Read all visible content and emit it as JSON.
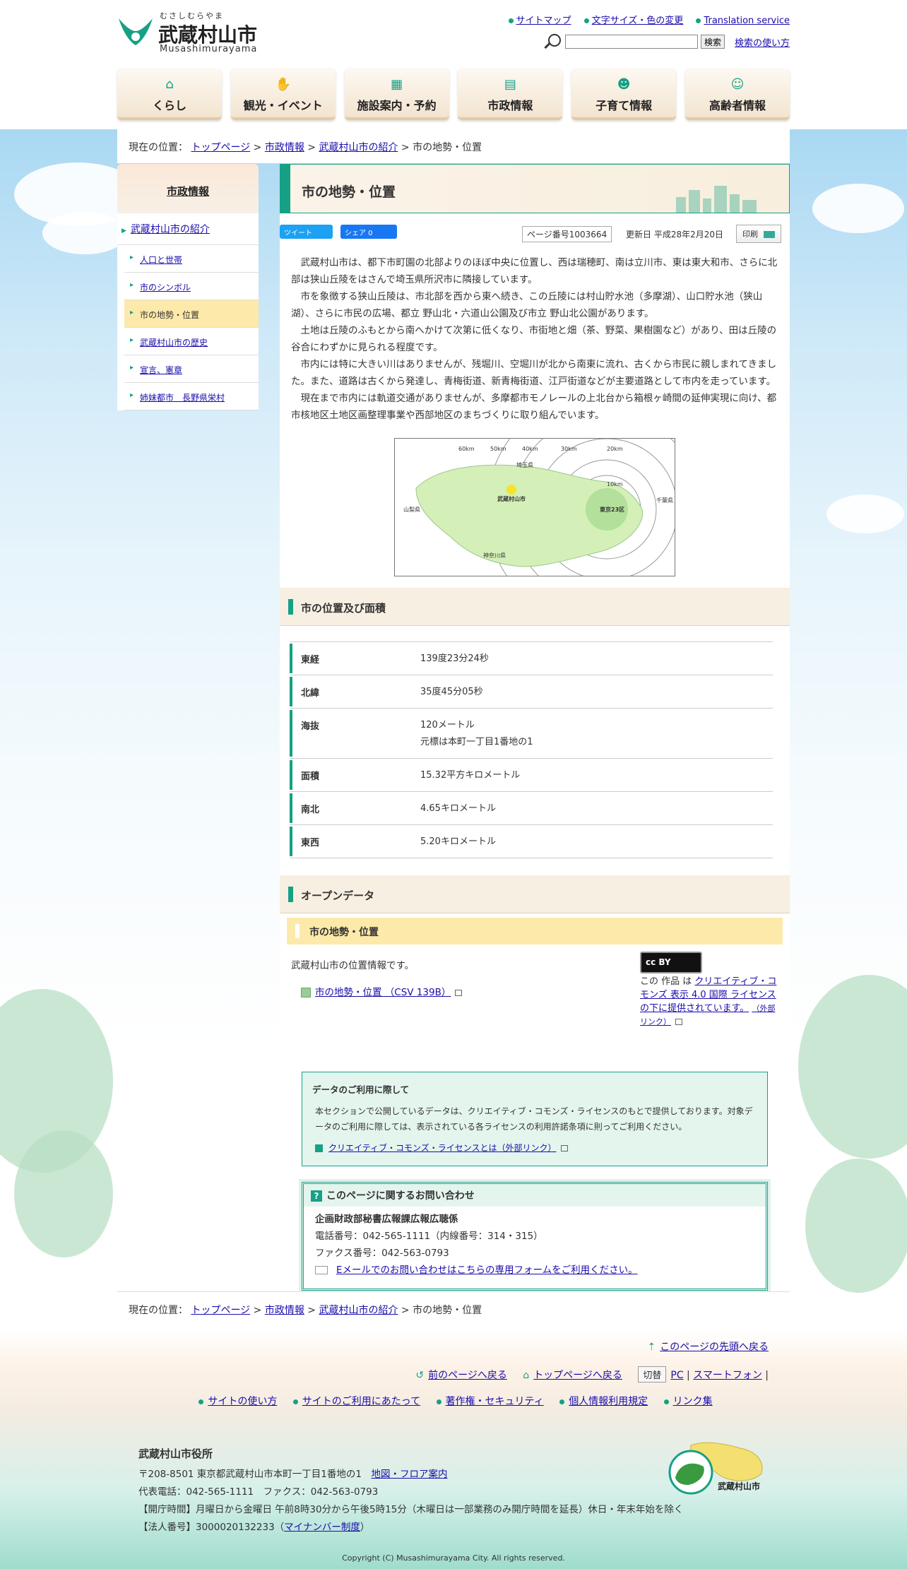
{
  "site": {
    "logo_kana": "むさしむらやま",
    "logo_name": "武蔵村山市",
    "logo_roman": "Musashimurayama"
  },
  "header": {
    "links": [
      "サイトマップ",
      "文字サイズ・色の変更",
      "Translation service"
    ],
    "search_button": "検索",
    "search_help": "検索の使い方",
    "search_value": ""
  },
  "gnav": [
    {
      "label": "くらし",
      "icon": "house-icon"
    },
    {
      "label": "観光・イベント",
      "icon": "handshake-icon"
    },
    {
      "label": "施設案内・予約",
      "icon": "building-icon"
    },
    {
      "label": "市政情報",
      "icon": "document-icon"
    },
    {
      "label": "子育て情報",
      "icon": "child-icon"
    },
    {
      "label": "高齢者情報",
      "icon": "elder-icon"
    }
  ],
  "breadcrumb": {
    "prefix": "現在の位置：",
    "items": [
      "トップページ",
      "市政情報",
      "武蔵村山市の紹介"
    ],
    "current": "市の地勢・位置",
    "sep": ">"
  },
  "sidebar": {
    "title": "市政情報",
    "section": "武蔵村山市の紹介",
    "items": [
      {
        "label": "人口と世帯",
        "current": false
      },
      {
        "label": "市のシンボル",
        "current": false
      },
      {
        "label": "市の地勢・位置",
        "current": true
      },
      {
        "label": "武蔵村山市の歴史",
        "current": false
      },
      {
        "label": "宣言、憲章",
        "current": false
      },
      {
        "label": "姉妹都市　長野県栄村",
        "current": false
      }
    ]
  },
  "page": {
    "title": "市の地勢・位置",
    "tweet": "ツイート",
    "share": "シェア 0",
    "page_number": "ページ番号1003664",
    "updated": "更新日 平成28年2月20日",
    "print": "印刷",
    "paragraphs": [
      "武蔵村山市は、都下市町園の北部よりのほぼ中央に位置し、西は瑞穂町、南は立川市、東は東大和市、さらに北部は狭山丘陵をはさんで埼玉県所沢市に隣接しています。",
      "市を象徴する狭山丘陵は、市北部を西から東へ続き、この丘陵には村山貯水池（多摩湖）、山口貯水池（狭山湖）、さらに市民の広場、都立 野山北・六道山公園及び市立 野山北公園があります。",
      "土地は丘陵のふもとから南へかけて次第に低くなり、市街地と畑（茶、野菜、果樹園など）があり、田は丘陵の谷合にわずかに見られる程度です。",
      "市内には特に大きい川はありませんが、残堀川、空堀川が北から南東に流れ、古くから市民に親しまれてきました。また、道路は古くから発達し、青梅街道、新青梅街道、江戸街道などが主要道路として市内を走っています。",
      "現在まで市内には軌道交通がありませんが、多摩都市モノレールの上北台から箱根ヶ崎間の延伸実現に向け、都市核地区土地区画整理事業や西部地区のまちづくりに取り組んでいます。"
    ]
  },
  "map": {
    "rings": [
      "60km",
      "50km",
      "40km",
      "30km",
      "20km",
      "10km"
    ],
    "labels": [
      "埼玉県",
      "山梨県",
      "武蔵村山市",
      "東京23区",
      "千葉県",
      "神奈川県"
    ]
  },
  "position": {
    "heading": "市の位置及び面積",
    "rows": [
      {
        "key": "東経",
        "value": "139度23分24秒",
        "value2": ""
      },
      {
        "key": "北緯",
        "value": "35度45分05秒",
        "value2": ""
      },
      {
        "key": "海抜",
        "value": "120メートル",
        "value2": "元標は本町一丁目1番地の1"
      },
      {
        "key": "面積",
        "value": "15.32平方キロメートル",
        "value2": ""
      },
      {
        "key": "南北",
        "value": "4.65キロメートル",
        "value2": ""
      },
      {
        "key": "東西",
        "value": "5.20キロメートル",
        "value2": ""
      }
    ]
  },
  "opendata": {
    "heading": "オープンデータ",
    "subheading": "市の地勢・位置",
    "desc": "武蔵村山市の位置情報です。",
    "csv_link": "市の地勢・位置 （CSV 139B）",
    "cc_badge": "cc BY",
    "cc_prefix": "この 作品 は",
    "cc_link": "クリエイティブ・コモンズ 表示 4.0 国際 ライセンスの下に提供されています。",
    "cc_ext": "（外部リンク）"
  },
  "notice": {
    "title": "データのご利用に際して",
    "text": "本セクションで公開しているデータは、クリエイティブ・コモンズ・ライセンスのもとで提供しております。対象データのご利用に際しては、表示されている各ライセンスの利用許諾条項に則ってご利用ください。",
    "link": "クリエイティブ・コモンズ・ライセンスとは（外部リンク）"
  },
  "contact": {
    "title": "このページに関するお問い合わせ",
    "dept": "企画財政部秘書広報課広報広聴係",
    "tel": "電話番号：042-565-1111（内線番号：314・315）",
    "fax": "ファクス番号：042-563-0793",
    "mail_link": "Eメールでのお問い合わせはこちらの専用フォームをご利用ください。"
  },
  "footer": {
    "page_top": "このページの先頭へ戻る",
    "prev": "前のページへ戻る",
    "top": "トップページへ戻る",
    "switch": "切替",
    "pc": "PC",
    "sp": "スマートフォン",
    "links": [
      "サイトの使い方",
      "サイトのご利用にあたって",
      "著作権・セキュリティ",
      "個人情報利用規定",
      "リンク集"
    ],
    "org": "武蔵村山市役所",
    "address": "〒208-8501 東京都武蔵村山市本町一丁目1番地の1",
    "map_link": "地図・フロア案内",
    "phone": "代表電話：042-565-1111　ファクス：042-563-0793",
    "hours": "【開庁時間】月曜日から金曜日 午前8時30分から午後5時15分（木曜日は一部業務のみ開庁時間を延長）休日・年末年始を除く",
    "corp_prefix": "【法人番号】3000020132233（",
    "corp_link": "マイナンバー制度",
    "corp_suffix": "）",
    "mascot_label": "武蔵村山市",
    "copyright": "Copyright (C) Musashimurayama City. All rights reserved."
  }
}
